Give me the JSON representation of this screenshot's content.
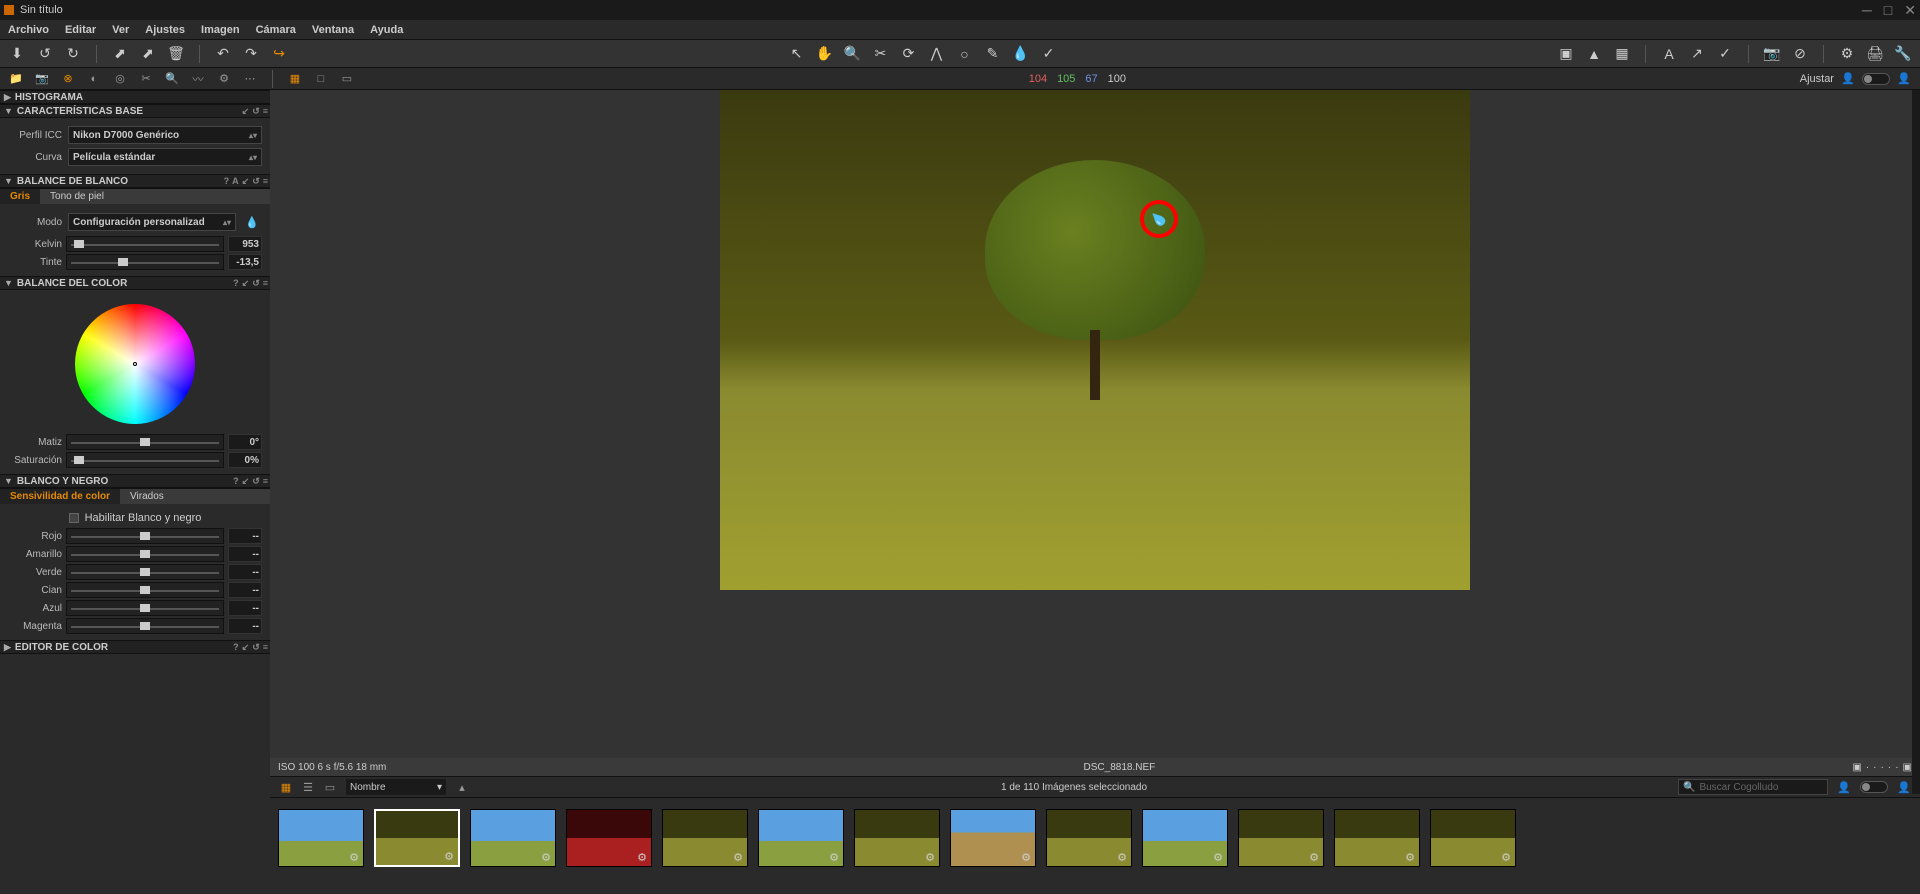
{
  "title": "Sin título",
  "menu": [
    "Archivo",
    "Editar",
    "Ver",
    "Ajustes",
    "Imagen",
    "Cámara",
    "Ventana",
    "Ayuda"
  ],
  "rgb": {
    "r": "104",
    "g": "105",
    "b": "67",
    "k": "100"
  },
  "adjust_label": "Ajustar",
  "sections": {
    "histogram": "HISTOGRAMA",
    "base": "CARACTERÍSTICAS BASE",
    "wb": "BALANCE DE BLANCO",
    "cb": "BALANCE DEL COLOR",
    "bw": "BLANCO Y NEGRO",
    "ce": "EDITOR DE COLOR"
  },
  "base": {
    "profile_label": "Perfil ICC",
    "profile_value": "Nikon D7000 Genérico",
    "curve_label": "Curva",
    "curve_value": "Película estándar"
  },
  "wb": {
    "tab_gray": "Gris",
    "tab_skin": "Tono de piel",
    "mode_label": "Modo",
    "mode_value": "Configuración personalizad",
    "kelvin_label": "Kelvin",
    "kelvin_value": "953",
    "tint_label": "Tinte",
    "tint_value": "-13,5"
  },
  "cb": {
    "hue_label": "Matiz",
    "hue_value": "0°",
    "sat_label": "Saturación",
    "sat_value": "0%"
  },
  "bw": {
    "tab_sens": "Sensivilidad de color",
    "tab_tone": "Virados",
    "enable_label": "Habilitar Blanco y negro",
    "channels": [
      {
        "name": "Rojo",
        "val": "--"
      },
      {
        "name": "Amarillo",
        "val": "--"
      },
      {
        "name": "Verde",
        "val": "--"
      },
      {
        "name": "Cian",
        "val": "--"
      },
      {
        "name": "Azul",
        "val": "--"
      },
      {
        "name": "Magenta",
        "val": "--"
      }
    ]
  },
  "caption": {
    "exif": "ISO 100 6 s f/5.6 18 mm",
    "file": "DSC_8818.NEF"
  },
  "browser": {
    "sort_label": "Nombre",
    "status": "1 de 110 Imágenes seleccionado",
    "search_placeholder": "Buscar Cogolludo"
  }
}
